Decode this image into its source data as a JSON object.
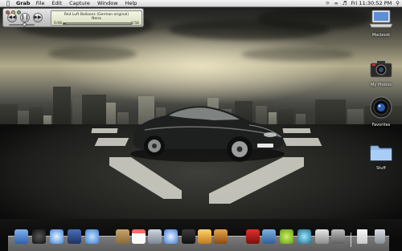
{
  "menubar": {
    "app_name": "Grab",
    "items": [
      "File",
      "Edit",
      "Capture",
      "Window",
      "Help"
    ],
    "clock": "Fri 11:30:52 PM",
    "tray_icons": [
      "wifi-icon",
      "bluetooth-icon",
      "volume-icon",
      "spotlight-icon"
    ]
  },
  "player": {
    "song_title": "Red Luft Balloons (German original)",
    "artist": "Nena",
    "elapsed": "0:06",
    "remaining": "3:56",
    "progress": 0.03
  },
  "desktop_icons": [
    {
      "name": "macbook-hd-icon",
      "label": "Macbook"
    },
    {
      "name": "camera-icon",
      "label": "My Photos"
    },
    {
      "name": "lens-icon",
      "label": "Favorites"
    },
    {
      "name": "folder-icon",
      "label": "Stuff"
    }
  ],
  "dock": {
    "items": [
      "finder-icon",
      "dashboard-icon",
      "safari-icon",
      "xcode-icon",
      "ichat-icon",
      "address-book-icon",
      "ical-icon",
      "iphoto-icon",
      "itunes-icon",
      "camera-icon",
      "preview-icon",
      "garageband-icon",
      "photobooth-icon",
      "spaces-icon",
      "widget-icon",
      "timemachine-icon",
      "utilities-icon",
      "system-preferences-icon",
      "document-icon",
      "trash-icon"
    ]
  }
}
